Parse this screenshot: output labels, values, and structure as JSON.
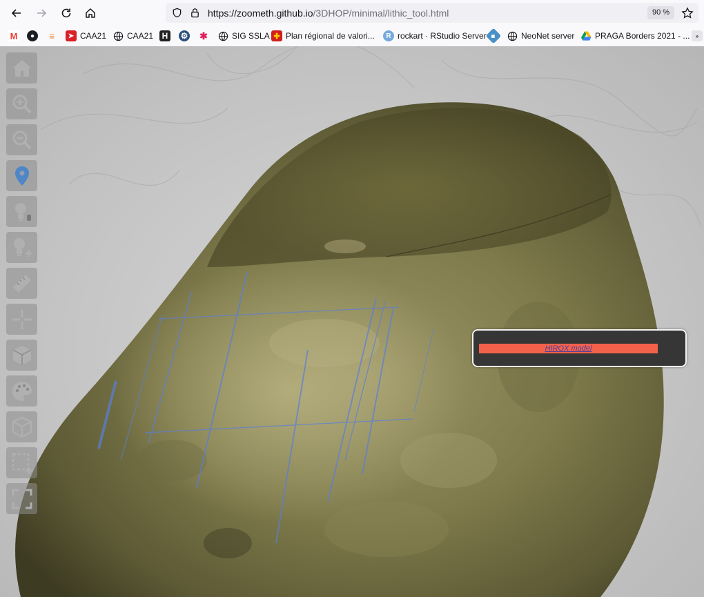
{
  "browser": {
    "url_host": "https://zoometh.github.io",
    "url_path": "/3DHOP/minimal/lithic_tool.html",
    "zoom": "90 %",
    "nav_icons": [
      "back-icon",
      "forward-icon",
      "reload-icon",
      "home-icon"
    ],
    "bookmarks": [
      {
        "icon": "gmail-icon",
        "label": ""
      },
      {
        "icon": "github-icon",
        "label": ""
      },
      {
        "icon": "stackoverflow-icon",
        "label": ""
      },
      {
        "icon": "caa-red-icon",
        "label": "CAA21"
      },
      {
        "icon": "globe-icon",
        "label": "CAA21"
      },
      {
        "icon": "h-icon",
        "label": ""
      },
      {
        "icon": "gear-icon",
        "label": ""
      },
      {
        "icon": "slack-icon",
        "label": ""
      },
      {
        "icon": "globe-icon",
        "label": "SIG SSLA"
      },
      {
        "icon": "occitanie-icon",
        "label": "Plan régional de valori..."
      },
      {
        "icon": "r-icon",
        "label": "rockart · RStudio Server"
      },
      {
        "icon": "shiny-icon",
        "label": ""
      },
      {
        "icon": "globe-icon",
        "label": "NeoNet server"
      },
      {
        "icon": "drive-icon",
        "label": "PRAGA Borders 2021 - ..."
      },
      {
        "icon": "overflow-icon",
        "label": ""
      }
    ]
  },
  "viewer": {
    "tools": [
      "home-icon",
      "zoom-in-icon",
      "zoom-out-icon",
      "pick-point-icon",
      "light-icon",
      "light-add-icon",
      "measure-ruler-icon",
      "crosshair-icon",
      "cube-solid-icon",
      "palette-icon",
      "cube-wire-icon",
      "sections-icon",
      "fullscreen-icon"
    ],
    "panel": {
      "link_label": "HIROX model"
    },
    "colors": {
      "panel_bg": "#363636",
      "panel_button": "#f4614a",
      "stone_base": "#7c7748"
    }
  }
}
